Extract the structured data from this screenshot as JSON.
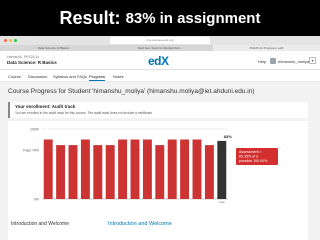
{
  "slide": {
    "headline_strong": "Result:",
    "headline_accent": "83%",
    "headline_rest": "in assignment",
    "colors": {
      "accent": "#ffffff"
    }
  },
  "browser": {
    "url": "lms.courses.edx.org",
    "tabs": [
      "Data Science: R Basics",
      "Next Gen Tools for Studied Anti...",
      "PH125.1x Progress | edX"
    ]
  },
  "header": {
    "course_org": "HarvardX: PH125.1x",
    "course_name": "Data Science: R Basics",
    "logo_text": "edX",
    "help_label": "Help",
    "user_name": "himanshu_moliya",
    "menu_icon": "chevron-down-icon",
    "brand_color": "#0075b4"
  },
  "course_tabs": [
    "Course",
    "Discussion",
    "Syllabus and FAQs",
    "Progress",
    "Notes"
  ],
  "active_tab": "Progress",
  "progress": {
    "title": "Course Progress for Student 'himanshu_moliya' (himanshu.moliya@iet.ahduni.edu.in)",
    "enrollment_title": "Your enrollment: Audit track",
    "enrollment_text": "You are enrolled in the audit track for this course. The audit track does not include a certificate."
  },
  "chart_data": {
    "type": "bar",
    "values": [
      0.85,
      0.77,
      0.77,
      0.85,
      0.77,
      0.77,
      0.85,
      0.85,
      0.85,
      0.77,
      0.85,
      0.85,
      0.85,
      0.77,
      0.83
    ],
    "categories": [
      "",
      "",
      "",
      "",
      "",
      "",
      "",
      "",
      "",
      "",
      "",
      "",
      "",
      "",
      "Total"
    ],
    "ylim": [
      0,
      1
    ],
    "y_ticks": [
      {
        "value": 0,
        "label": "0%"
      },
      {
        "value": 0.7,
        "label": "Pass 70%"
      },
      {
        "value": 1,
        "label": "100%"
      }
    ],
    "total_label": "83%",
    "tooltip_lines": [
      "Assessment =",
      "83.35% of a",
      "possible 100.00%"
    ],
    "bar_color": "#cc3333",
    "total_color": "#333333",
    "grid": true
  },
  "sections": {
    "left_title": "Introduction and Welcome",
    "right_title": "Introduction and Welcome"
  }
}
